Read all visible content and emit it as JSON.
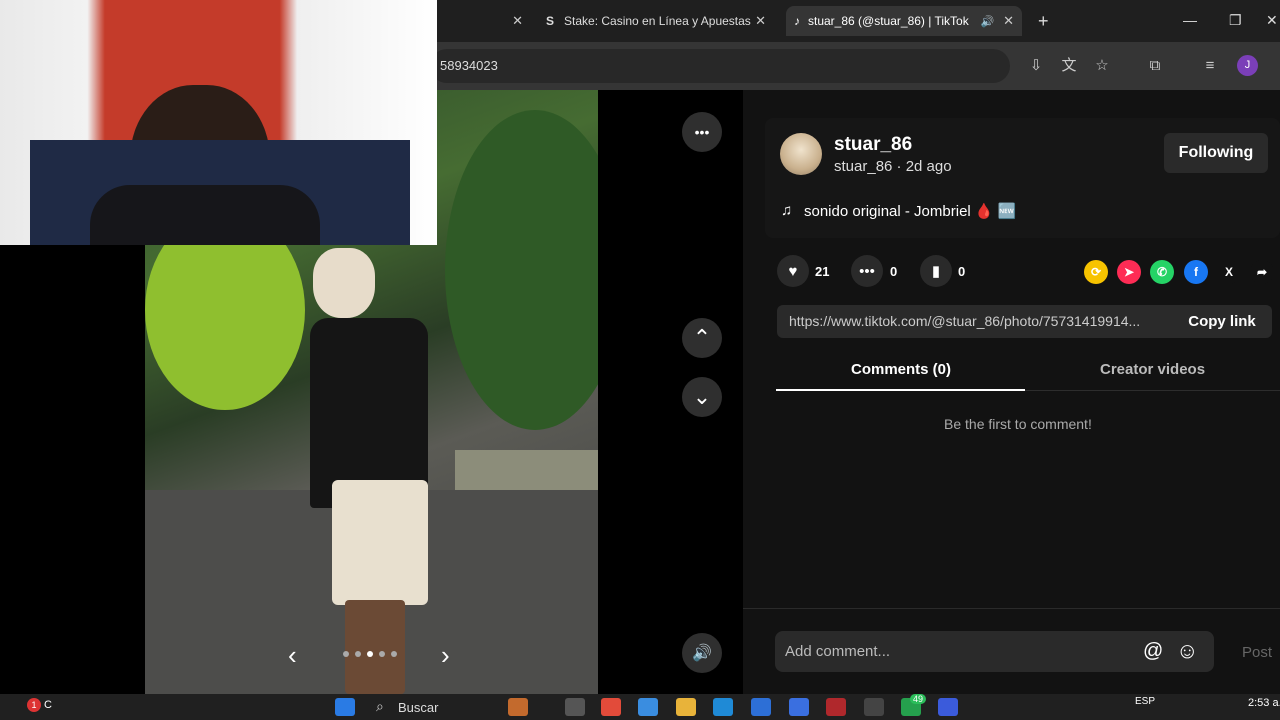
{
  "browser": {
    "tabs": [
      {
        "title": "",
        "close": "✕"
      },
      {
        "title": "Stake: Casino en Línea y Apuestas",
        "favicon": "S",
        "close": "✕"
      },
      {
        "title": "stuar_86 (@stuar_86) | TikTok",
        "favicon": "♪",
        "close": "✕",
        "audio": "🔊"
      }
    ],
    "new_tab": "+",
    "address_text": "58934023",
    "profile_initial": "J",
    "window_controls": {
      "minimize": "—",
      "restore": "❐",
      "close": "✕"
    }
  },
  "viewer": {
    "more_icon": "•••",
    "up_icon": "⌃",
    "down_icon": "⌄",
    "sound_icon": "🔊",
    "prev_icon": "‹",
    "next_icon": "›",
    "slide_count": 5,
    "current_slide": 3
  },
  "post": {
    "username": "stuar_86",
    "meta": "stuar_86 · 2d ago",
    "follow_label": "Following",
    "sound_icon": "♫",
    "sound_text": "sonido original - Jombriel 🩸 🆕",
    "likes": "21",
    "comments": "0",
    "saves": "0",
    "link": "https://www.tiktok.com/@stuar_86/photo/75731419914...",
    "copy_label": "Copy link",
    "tab_comments": "Comments (0)",
    "tab_creator": "Creator videos",
    "empty_text": "Be the first to comment!",
    "comment_placeholder": "Add comment...",
    "at_icon": "@",
    "emoji_icon": "☺",
    "post_label": "Post"
  },
  "share_icons": [
    {
      "name": "repost",
      "glyph": "⟳",
      "color": "#f7c300"
    },
    {
      "name": "send",
      "glyph": "➤",
      "color": "#fe2c55"
    },
    {
      "name": "whatsapp",
      "glyph": "✆",
      "color": "#25d366"
    },
    {
      "name": "facebook",
      "glyph": "f",
      "color": "#1877f2"
    },
    {
      "name": "x",
      "glyph": "X",
      "color": "#121212"
    },
    {
      "name": "more-share",
      "glyph": "➦",
      "color": "#121212"
    }
  ],
  "taskbar": {
    "search_label": "Buscar",
    "lang": "ESP",
    "time": "2:53 a.",
    "notif_count": "1",
    "badge_count": "49",
    "weather_label": "C"
  }
}
